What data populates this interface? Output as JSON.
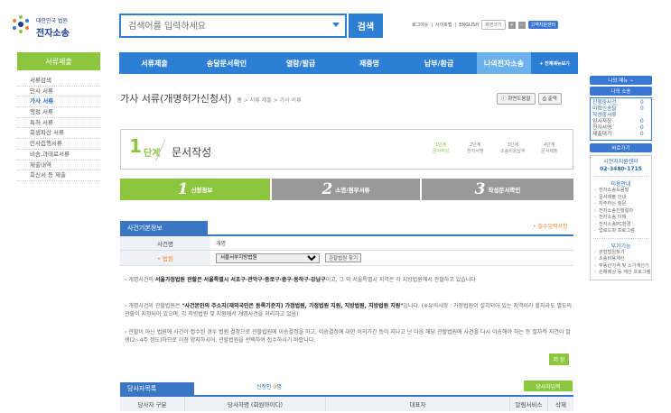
{
  "header": {
    "logo_line1": "대한민국 법원",
    "logo_line2": "전자소송",
    "search_placeholder": "검색어를 입력하세요",
    "search_button": "검색",
    "top_links": [
      "로그아웃",
      "사이트맵",
      "ENGLISH"
    ],
    "zoom_label": "화면크기",
    "zoom_plus": "+",
    "zoom_minus": "-",
    "help_center": "고객지원센터"
  },
  "nav": {
    "items": [
      "서류제출",
      "송달문서확인",
      "열람/발급",
      "제증명",
      "납부/환급",
      "나의전자소송"
    ],
    "all_menu": "+ 전체메뉴보기",
    "active_index": 5
  },
  "left_sidebar": {
    "title": "서류제출",
    "items": [
      "서류검색",
      "민사 서류",
      "가사 서류",
      "행정 서류",
      "특허 서류",
      "회생파산 서류",
      "민사집행서류",
      "비송,과태료서류",
      "제출내역",
      "회신서 등 제출"
    ],
    "active_index": 2
  },
  "page": {
    "title": "가사 서류(개명허가신청서)",
    "breadcrumb": "홈 > 서류 제출 > 가사 서류",
    "help_button": "화면도움말",
    "print_button": "출력"
  },
  "steps": {
    "current_num": "1",
    "current_word": "단계",
    "current_name": "문서작성",
    "list": [
      {
        "top": "1단계",
        "bottom": "문서작성"
      },
      {
        "top": "2단계",
        "bottom": "전자서명"
      },
      {
        "top": "3단계",
        "bottom": "소송비용납부"
      },
      {
        "top": "4단계",
        "bottom": "문서제출"
      }
    ]
  },
  "tabs": [
    {
      "num": "1",
      "label": "신청정보"
    },
    {
      "num": "2",
      "label": "소명/첨부서류"
    },
    {
      "num": "3",
      "label": "작성문서확인"
    }
  ],
  "case_info": {
    "title": "사건기본정보",
    "required_note": "• 필수입력사항",
    "row1_label": "사건명",
    "row1_value": "개명",
    "row2_label": "• 법원",
    "court_selected": "서울서부지방법원",
    "court_button": "관할법원 찾기"
  },
  "notes": [
    {
      "pre": "› 개명사건의 ",
      "bold": "서울가정법원 관할은 서울특별시 서초구·관악구·종로구·중구·동작구·강남구",
      "post": "이고, 그 외 서울특별시 지역은 각 지방법원에서 관할하고 있습니다"
    },
    {
      "pre": "› 개명사건의 관할법원은 ",
      "bold": "\"사건본인의 주소지(재외국민은 등록기준지) 가정법원, 가정법원 지원, 지방법원, 지방법원 지원\"",
      "post": "입니다. (※유의사항 : 가정법원이 설치되어 있는 지역이라 할지라도 별도의 관할이 지정되어 있으며, 각 지방법원 및 지원에서 개명사건을 처리하고 있음)"
    },
    {
      "pre": "› 관할이 아닌 법원에 사건이 접수된 경우 법원 결정으로 관할법원에 이송결정을 하고, 이송결정에 대한 이의기간 등이 지나고 난 다음 해당 관할법원에 사건을 다시 이송해야 하는 등 절차적 지연이 발생(2~4주 정도)하므로 이점 양지하시어, 관할법원을 선택하여 접수하시기 바랍니다.",
      "bold": "",
      "post": ""
    }
  ],
  "save_button": "저 장",
  "parties": {
    "title": "당사자목록",
    "applicant_label": "신청인",
    "applicant_count": "0",
    "applicant_unit": "명",
    "add_button": "당사자입력",
    "columns": [
      "당사자 구분",
      "당사자명 (회원아이디)",
      "대표자",
      "알림서비스",
      "삭제"
    ]
  },
  "right_sidebar": {
    "my_menu": "나의 메뉴",
    "my_suit": "나의 소송",
    "stats": [
      {
        "label": "진행중사건",
        "value": "0"
      },
      {
        "label": "미확인송달",
        "value": "0"
      },
      {
        "label": "작성중서류",
        "value": ""
      },
      {
        "label": "임시저장",
        "value": "0"
      },
      {
        "label": "전자서명",
        "value": "0"
      },
      {
        "label": "제출대기",
        "value": "0"
      }
    ],
    "shortcut": "바로가기",
    "call_center": "시전자지원센터",
    "phone": "02-3480-1715",
    "usage_title": "이용안내",
    "usage_items": [
      "전자소송도움말",
      "문서제출 안내",
      "자주하는 질문",
      "전자소송진행절차",
      "전자소송 이해",
      "전자소송PC환경",
      "업로드파 프로그램"
    ],
    "extra_title": "부가기능",
    "extra_items": [
      "관할법원찾기",
      "소송비용계산",
      "부동산가격 및 소가계산기",
      "손해배상 등 계산 프로그램"
    ]
  }
}
